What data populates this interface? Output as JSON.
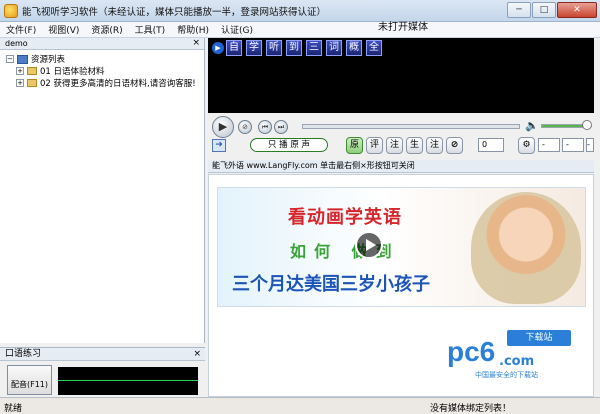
{
  "window": {
    "title": "能飞视听学习软件（未经认证，媒体只能播放一半，登录网站获得认证）",
    "minimize": "─",
    "maximize": "□",
    "close": "✕"
  },
  "menu": [
    "文件(F)",
    "视图(V)",
    "资源(R)",
    "工具(T)",
    "帮助(H)",
    "认证(G)"
  ],
  "left_panel": {
    "header": "demo",
    "close": "×",
    "root": "资源列表",
    "items": [
      "01 日语体验材料",
      "02 获得更多高清的日语材料,请咨询客服!"
    ]
  },
  "media": {
    "title": "未打开媒体",
    "subtitle_chars": [
      "自",
      "学",
      "听",
      "到",
      "三",
      "词",
      "概",
      "全"
    ]
  },
  "controls": {
    "source_select": "只 播 原 声",
    "mode_buttons": [
      "原",
      "评",
      "注",
      "生",
      "注"
    ],
    "speed_select": "0",
    "dash1": "-",
    "dash2": "-",
    "dash3": "-"
  },
  "web": {
    "header": "能飞外语 www.LangFly.com 单击最右侧×形按钮可关闭",
    "banner_line1": "看动画学英语",
    "banner_line2": "如何 做到",
    "banner_line3": "三个月达美国三岁小孩子",
    "logo_text": "pc6",
    "logo_com": ".com",
    "logo_badge": "下载站",
    "logo_slogan": "中国最安全的下载站"
  },
  "practice": {
    "header": "口语练习",
    "close": "×",
    "dub_button": "配音(F11)"
  },
  "status": {
    "left": "就绪",
    "right": "没有媒体绑定列表！"
  }
}
